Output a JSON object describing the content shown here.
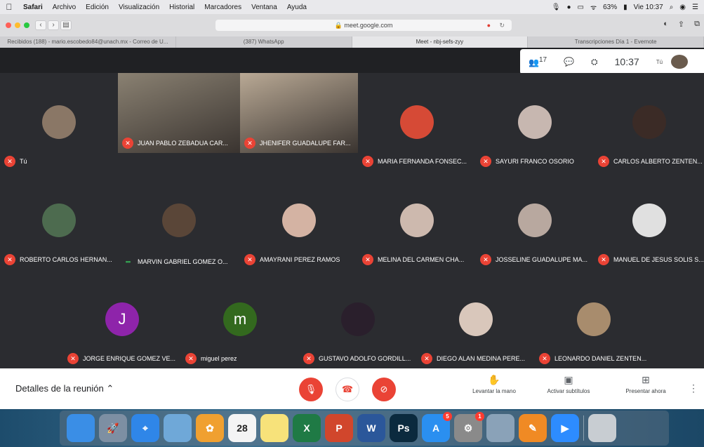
{
  "menubar": {
    "apple_icon": "apple-icon",
    "items": [
      "Safari",
      "Archivo",
      "Edición",
      "Visualización",
      "Historial",
      "Marcadores",
      "Ventana",
      "Ayuda"
    ],
    "battery": "63%",
    "clock": "Vie 10:37"
  },
  "browser": {
    "url": "meet.google.com",
    "tabs": [
      "Recibidos (188) - mario.escobedo84@unach.mx - Correo de U...",
      "(387) WhatsApp",
      "Meet - nbj-sefs-zyy",
      "Transcripciones Día 1 - Evernote"
    ],
    "active_tab": 2
  },
  "meet_panel": {
    "people_count": "17",
    "time": "10:37",
    "self_label": "Tú"
  },
  "participants": [
    {
      "name": "Tú",
      "muted": true,
      "avatar_color": "#8a7766"
    },
    {
      "name": "JUAN PABLO ZEBADUA CAR...",
      "muted": true,
      "video": true,
      "video_color": "#8a8172"
    },
    {
      "name": "JHENIFER GUADALUPE FAR...",
      "muted": true,
      "video": true,
      "video_color": "#b9a995"
    },
    {
      "name": "MARIA FERNANDA FONSEC...",
      "muted": true,
      "avatar_color": "#d64a36"
    },
    {
      "name": "SAYURI FRANCO OSORIO",
      "muted": true,
      "avatar_color": "#c7b7b0"
    },
    {
      "name": "CARLOS ALBERTO ZENTEN...",
      "muted": true,
      "avatar_color": "#3b2b26"
    },
    {
      "name": "ROBERTO CARLOS HERNAN...",
      "muted": true,
      "avatar_color": "#4d6b4f"
    },
    {
      "name": "MARVIN GABRIEL GOMEZ O...",
      "muted": false,
      "avatar_color": "#5a4638"
    },
    {
      "name": "AMAYRANI PEREZ RAMOS",
      "muted": true,
      "avatar_color": "#d4b3a3"
    },
    {
      "name": "MELINA DEL CARMEN CHA...",
      "muted": true,
      "avatar_color": "#cdb9ae"
    },
    {
      "name": "JOSSELINE GUADALUPE MA...",
      "muted": true,
      "avatar_color": "#b8a89f"
    },
    {
      "name": "MANUEL DE JESUS SOLIS S...",
      "muted": true,
      "avatar_color": "#e0e0e0"
    },
    {
      "name": "JORGE ENRIQUE GOMEZ VE...",
      "muted": true,
      "avatar_color": "#8e24aa",
      "initial": "J"
    },
    {
      "name": "miguel perez",
      "muted": true,
      "avatar_color": "#33691e",
      "initial": "m"
    },
    {
      "name": "GUSTAVO ADOLFO GORDILL...",
      "muted": true,
      "avatar_color": "#2a1f2c"
    },
    {
      "name": "DIEGO ALAN MEDINA PERE...",
      "muted": true,
      "avatar_color": "#d9c7bb"
    },
    {
      "name": "LEONARDO DANIEL ZENTEN...",
      "muted": true,
      "avatar_color": "#a88c6d"
    }
  ],
  "controls": {
    "details": "Detalles de la reunión",
    "raise_hand": "Levantar la mano",
    "captions": "Activar subtítulos",
    "present": "Presentar ahora"
  },
  "dock": {
    "apps": [
      {
        "name": "finder-icon",
        "color": "#3a8ee6",
        "glyph": ""
      },
      {
        "name": "launchpad-icon",
        "color": "#7d8fa3",
        "glyph": "🚀"
      },
      {
        "name": "safari-icon",
        "color": "#2f86e8",
        "glyph": "⌖"
      },
      {
        "name": "preview-icon",
        "color": "#6fa8d8",
        "glyph": ""
      },
      {
        "name": "photos-icon",
        "color": "#f0a030",
        "glyph": "✿"
      },
      {
        "name": "calendar-icon",
        "color": "#f4f4f4",
        "glyph": "28"
      },
      {
        "name": "notes-icon",
        "color": "#f7e27a",
        "glyph": ""
      },
      {
        "name": "excel-icon",
        "color": "#1f7a45",
        "glyph": "X"
      },
      {
        "name": "powerpoint-icon",
        "color": "#d1462c",
        "glyph": "P"
      },
      {
        "name": "word-icon",
        "color": "#2b579a",
        "glyph": "W"
      },
      {
        "name": "photoshop-icon",
        "color": "#0b2a3e",
        "glyph": "Ps"
      },
      {
        "name": "app-store-icon",
        "color": "#2a8ff0",
        "glyph": "A",
        "badge": "5"
      },
      {
        "name": "system-preferences-icon",
        "color": "#8a8a8a",
        "glyph": "⚙",
        "badge": "1"
      },
      {
        "name": "image-capture-icon",
        "color": "#8aa2b8",
        "glyph": ""
      },
      {
        "name": "pages-icon",
        "color": "#f08a24",
        "glyph": "✎"
      },
      {
        "name": "zoom-icon",
        "color": "#2d8cff",
        "glyph": "▶"
      },
      {
        "name": "trash-icon",
        "color": "#c8cdd2",
        "glyph": ""
      }
    ]
  }
}
